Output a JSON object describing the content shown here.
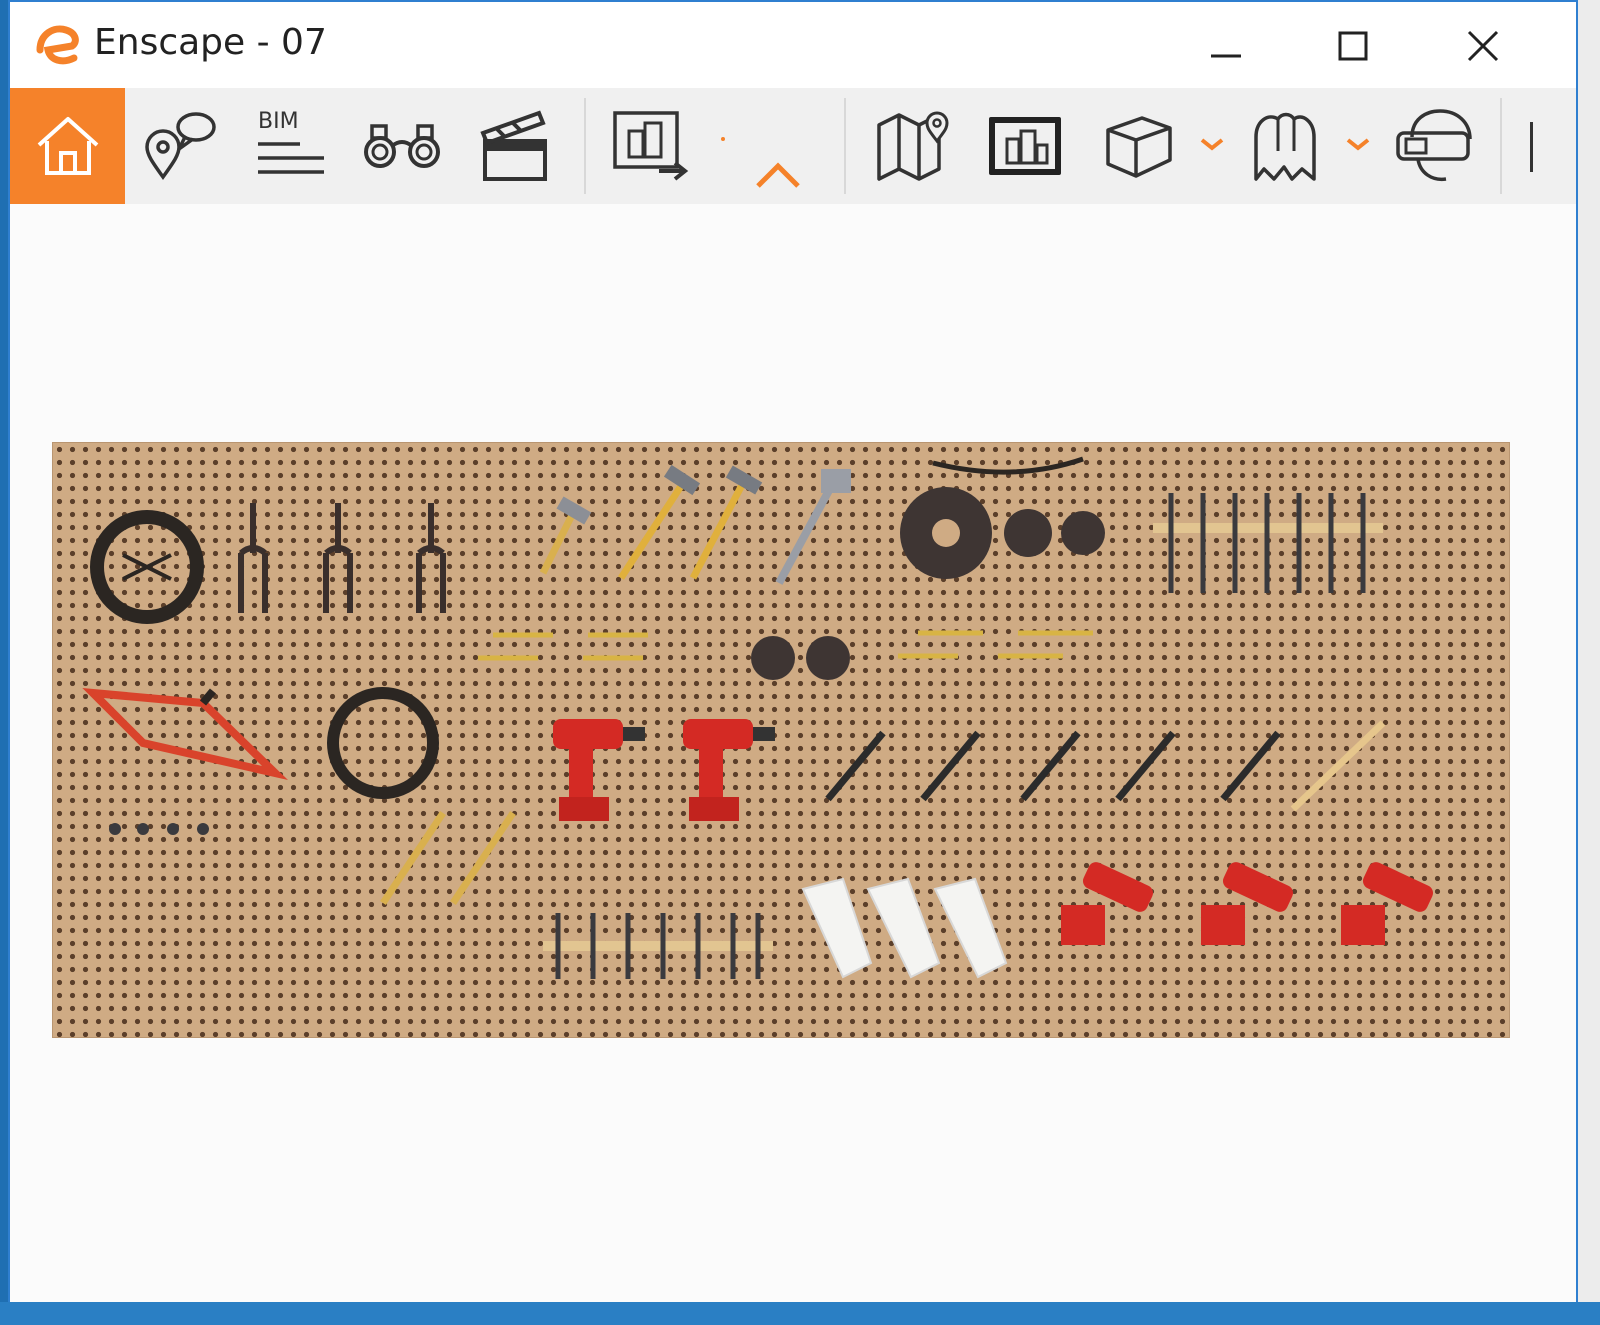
{
  "window": {
    "title": "Enscape - 07",
    "controls": {
      "minimize": "minimize",
      "maximize": "maximize",
      "close": "close"
    }
  },
  "toolbar": {
    "bim_label": "BIM",
    "buttons": [
      {
        "name": "home",
        "icon": "home-icon",
        "active": true
      },
      {
        "name": "views",
        "icon": "map-pin-chat-icon"
      },
      {
        "name": "bim",
        "icon": "bim-lines-icon"
      },
      {
        "name": "binoculars",
        "icon": "binoculars-icon"
      },
      {
        "name": "video",
        "icon": "clapperboard-icon"
      },
      {
        "name": "export",
        "icon": "export-screen-icon"
      },
      {
        "name": "map",
        "icon": "map-pin-icon"
      },
      {
        "name": "screen",
        "icon": "buildings-screen-icon"
      },
      {
        "name": "cube",
        "icon": "cube-icon"
      },
      {
        "name": "asset",
        "icon": "ghost-icon"
      },
      {
        "name": "vr",
        "icon": "vr-headset-icon"
      }
    ]
  },
  "colors": {
    "accent": "#f5822a",
    "pegboard": "#cfab84",
    "hole": "#5b3f2a",
    "drill_red": "#d42a24"
  }
}
